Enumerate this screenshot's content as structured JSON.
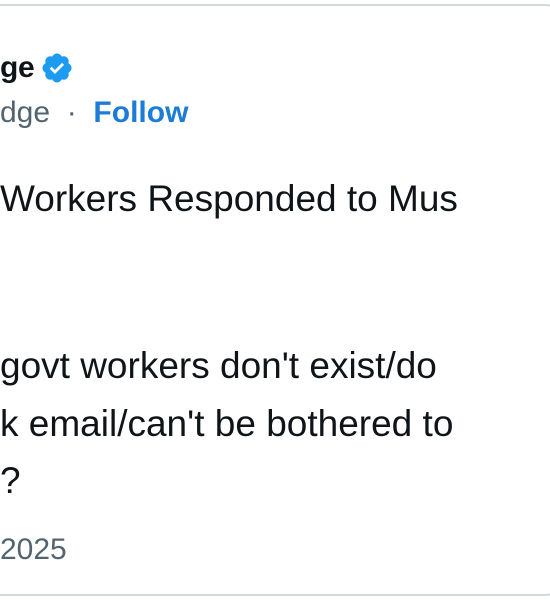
{
  "post": {
    "author_name_fragment": "ge",
    "handle_fragment": "dge",
    "separator": "·",
    "follow_label": "Follow",
    "headline": "Workers Responded to Mus",
    "body_lines": [
      "govt workers don't exist/do",
      "k email/can't be bothered to",
      "?"
    ],
    "date_fragment": "2025"
  },
  "colors": {
    "accent": "#1d7cd6",
    "verified_badge": "#1d9bf0",
    "text_primary": "#0f1419",
    "text_secondary": "#536471",
    "border": "#cfd9de"
  },
  "icons": {
    "verified": "verified-badge-icon"
  }
}
